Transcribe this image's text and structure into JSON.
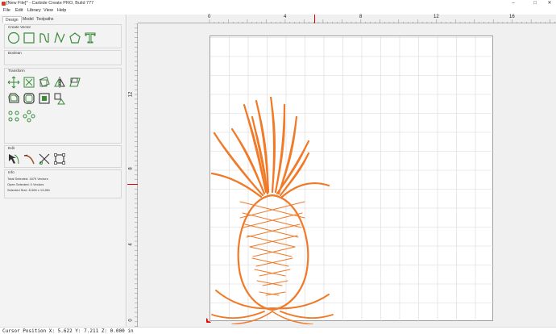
{
  "window": {
    "title": "[New File]* - Carbide Create PRO, Build 777",
    "controls": {
      "minimize": "–",
      "maximize": "□",
      "close": "✕"
    }
  },
  "menu": {
    "items": [
      "File",
      "Edit",
      "Library",
      "View",
      "Help"
    ]
  },
  "tabs": [
    "Design",
    "Model",
    "Toolpaths"
  ],
  "panel": {
    "create_vector": {
      "title": "Create Vector",
      "tools": [
        "circle-tool-icon",
        "rectangle-tool-icon",
        "curve-tool-icon",
        "polyline-tool-icon",
        "polygon-tool-icon",
        "text-tool-icon"
      ]
    },
    "boolean": {
      "title": "Boolean"
    },
    "transform": {
      "title": "Transform",
      "tools": [
        "move-icon",
        "scale-icon",
        "rotate-icon",
        "mirror-icon",
        "shear-icon",
        "offset-icon",
        "fillet-icon",
        "align-icon",
        "array-icon",
        "node-edit-icon",
        "circular-array-icon"
      ]
    },
    "edit": {
      "title": "Edit",
      "tools": [
        "node-edit-tool-icon",
        "bezier-icon",
        "trim-icon",
        "bounding-box-icon"
      ]
    },
    "info": {
      "title": "Info",
      "total_selected": "Total Selected:  1679 Vectors",
      "open_selected": "Open Selected:  0 Vectors",
      "selected_size": "Selected Size:   8.965 x 13.851"
    }
  },
  "rulers": {
    "x_ticks": [
      "0",
      "4",
      "8",
      "12",
      "16"
    ],
    "y_ticks": [
      "12",
      "8",
      "4",
      "0"
    ],
    "accent_color": "#e00000"
  },
  "artwork": {
    "color": "#f07a28"
  },
  "status": {
    "cursor_position": "Cursor Position X: 5.622 Y: 7.211 Z: 0.000 in"
  }
}
